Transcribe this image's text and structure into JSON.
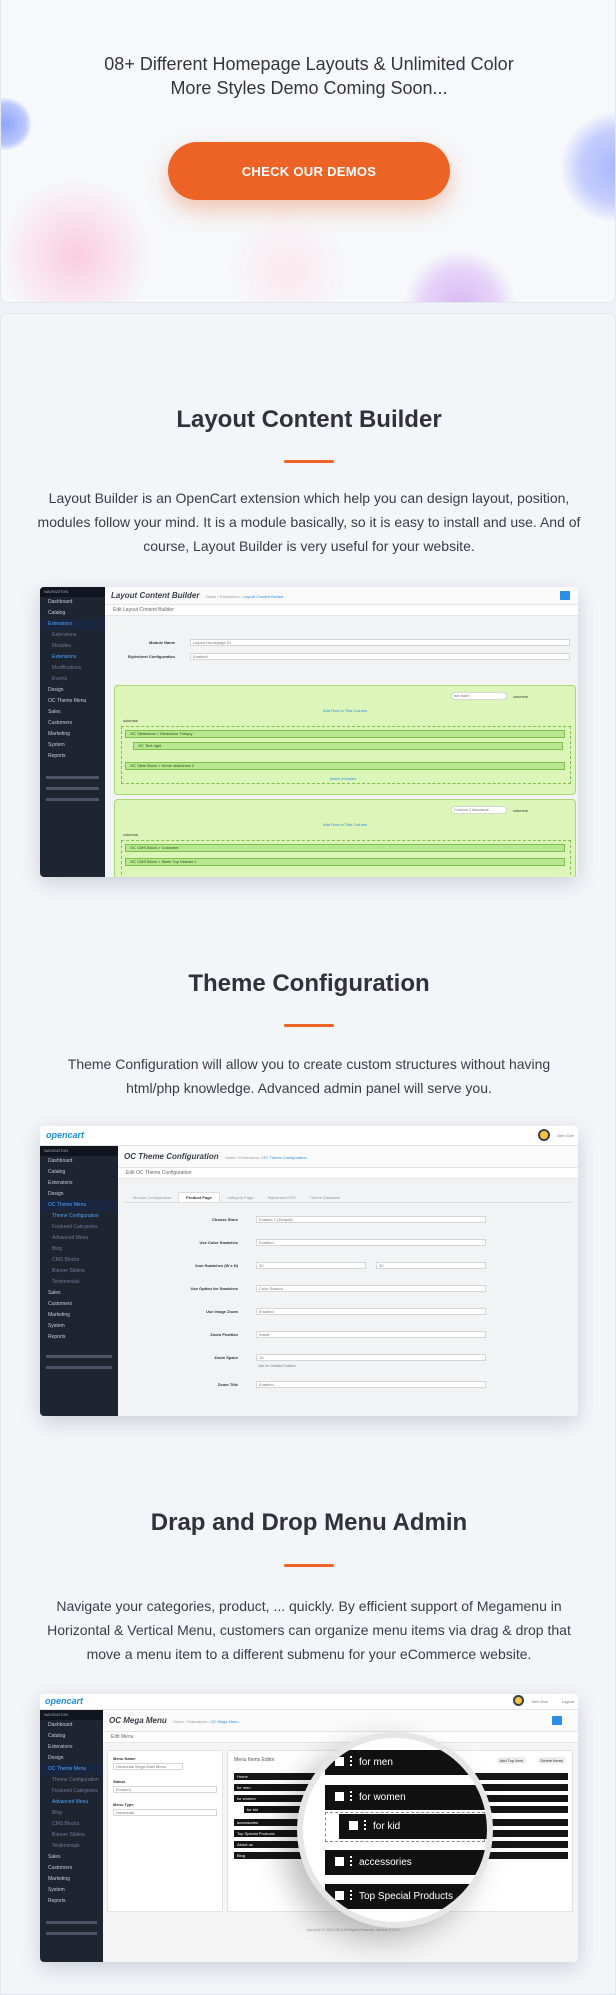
{
  "hero": {
    "line1": "08+ Different Homepage Layouts & Unlimited Color",
    "line2": "More Styles Demo Coming Soon...",
    "button": "CHECK OUR DEMOS",
    "accent": "#ed6325"
  },
  "sections": [
    {
      "title": "Layout Content Builder",
      "description": "Layout Builder is an OpenCart extension which help you can design layout, position, modules follow your mind. It is a module basically, so it is easy to install and use. And of course, Layout Builder is very useful for your website."
    },
    {
      "title": "Theme Configuration",
      "description": "Theme Configuration will allow you to create custom structures without having html/php knowledge. Advanced admin panel will serve you."
    },
    {
      "title": "Drap and Drop Menu Admin",
      "description": "Navigate your categories, product, ... quickly. By efficient support of Megamenu in Horizontal & Vertical Menu, customers can organize menu items via drag & drop that move a menu item to a different submenu for your eCommerce website."
    }
  ],
  "shot1": {
    "nav": "NAVIGATION",
    "sidebar": [
      "Dashboard",
      "Catalog",
      "Extensions",
      "Extensions",
      "Modules",
      "Extensions",
      "Modifications",
      "Events",
      "Design",
      "OC Theme Menu",
      "Sales",
      "Customers",
      "Marketing",
      "System",
      "Reports"
    ],
    "title": "Layout Content Builder",
    "breadcrumb_home": "Home",
    "breadcrumb_ext": "Extensions",
    "breadcrumb_current": "Layout Content Builder",
    "panel": "Edit Layout Content Builder",
    "module_name_label": "Module Name",
    "module_name_value": "Layout Homepage 01",
    "stylesheet_label": "Stylesheet Configuration",
    "stylesheet_value": "Enabled",
    "add_row": "Add Row In This Column",
    "row_class_1": "full width",
    "row_class_2": "Custom Classname",
    "columns": "columns",
    "row_items": [
      "OC Slideshow > Slideshow Theqoy",
      "OC Text right",
      "OC Slide Block > Home slideshow 2"
    ],
    "row_items_2": [
      "OC CMS Block > Customer",
      "OC CMS Block > Static Top Header 2"
    ],
    "insert_modules": "Insert modules"
  },
  "shot2": {
    "logo": "opencart",
    "user": "John Doe",
    "nav": "NAVIGATION",
    "sidebar": [
      "Dashboard",
      "Catalog",
      "Extensions",
      "Design",
      "OC Theme Menu",
      "Theme Configuration",
      "Featured Categories",
      "Advanced Menu",
      "Blog",
      "CMS Blocks",
      "Banner Sliders",
      "Testimonials",
      "Sales",
      "Customers",
      "Marketing",
      "System",
      "Reports"
    ],
    "title": "OC Theme Configuration",
    "breadcrumb_home": "Home",
    "breadcrumb_ext": "Extensions",
    "breadcrumb_current": "OC Theme Configuration",
    "panel": "Edit OC Theme Configuration",
    "tabs": [
      "Module Configuration",
      "Product Page",
      "Category Page",
      "Stylesheet CSS",
      "Theme Database"
    ],
    "fields": [
      {
        "label": "Choose Store",
        "value": "Enabler 1 (Default)"
      },
      {
        "label": "Use Color Swatches",
        "value": "Enabled"
      },
      {
        "label": "Icon Swatches (W x H)",
        "value": "30"
      },
      {
        "label": "Use Option for Swatches",
        "value": "Color Swatch"
      },
      {
        "label": "Use Image Zoom",
        "value": "Enabled"
      },
      {
        "label": "Zoom Position",
        "value": "Inside"
      },
      {
        "label": "Zoom Space",
        "value": "10"
      },
      {
        "label": "Zoom Title",
        "value": "Enabled"
      }
    ],
    "zoom_hint": "Use for Outside Position",
    "icon_h_value": "30"
  },
  "shot3": {
    "logo": "opencart",
    "user": "John Doe",
    "logout": "Logout",
    "nav": "NAVIGATION",
    "sidebar": [
      "Dashboard",
      "Catalog",
      "Extensions",
      "Design",
      "OC Theme Menu",
      "Theme Configuration",
      "Featured Categories",
      "Advanced Menu",
      "Blog",
      "CMS Blocks",
      "Banner Sliders",
      "Testimonials",
      "Sales",
      "Customers",
      "Marketing",
      "System",
      "Reports"
    ],
    "title": "OC Mega Menu",
    "breadcrumb_home": "Home",
    "breadcrumb_ext": "Extensions",
    "breadcrumb_current": "OC Mega Menu",
    "panel": "Edit Menu",
    "menu_name_label": "Menu Name",
    "menu_name_value": "Horizontal Mega Main Menu",
    "status_label": "Status",
    "status_value": "Enabled",
    "menu_type_label": "Menu Type",
    "menu_type_value": "Horizontal",
    "editor_title": "Menu Items Editor",
    "add_top": "Add Top Item",
    "delete_items": "Delete Items",
    "list_items": [
      "Home",
      "for men",
      "for women",
      "for kid",
      "accessories",
      "Top Special Products",
      "About us",
      "Blog"
    ],
    "magnified": [
      "for men",
      "for women",
      "for kid",
      "accessories",
      "Top Special Products"
    ],
    "footer": "OpenCart © 2009-2018 All Rights Reserved. Version 3.0.2.0"
  }
}
